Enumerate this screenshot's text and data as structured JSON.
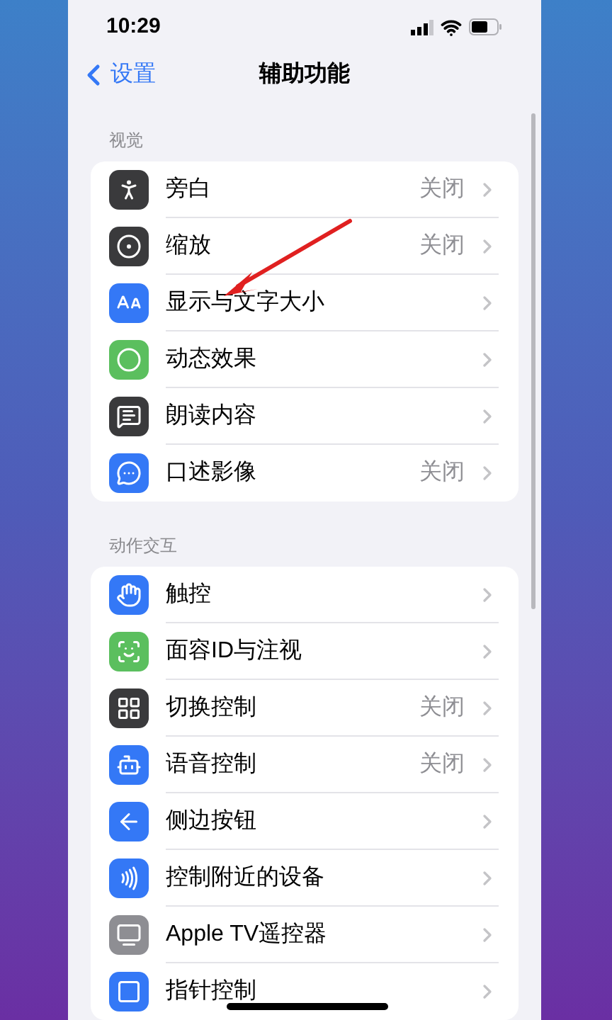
{
  "status_bar": {
    "time": "10:29"
  },
  "nav": {
    "back": "设置",
    "title": "辅助功能"
  },
  "sections": [
    {
      "header": "视觉",
      "items": [
        {
          "kind": "voiceover",
          "color": "#3a3a3c",
          "label": "旁白",
          "value": "关闭"
        },
        {
          "kind": "zoom",
          "color": "#3a3a3c",
          "label": "缩放",
          "value": "关闭"
        },
        {
          "kind": "text-size",
          "color": "#3478f6",
          "label": "显示与文字大小"
        },
        {
          "kind": "motion",
          "color": "#5bbf5e",
          "label": "动态效果"
        },
        {
          "kind": "spoken",
          "color": "#3a3a3c",
          "label": "朗读内容"
        },
        {
          "kind": "audio-desc",
          "color": "#3478f6",
          "label": "口述影像",
          "value": "关闭"
        }
      ]
    },
    {
      "header": "动作交互",
      "items": [
        {
          "kind": "touch",
          "color": "#3478f6",
          "label": "触控"
        },
        {
          "kind": "face-id",
          "color": "#5bbf5e",
          "label": "面容ID与注视"
        },
        {
          "kind": "switch",
          "color": "#3a3a3c",
          "label": "切换控制",
          "value": "关闭"
        },
        {
          "kind": "voice",
          "color": "#3478f6",
          "label": "语音控制",
          "value": "关闭"
        },
        {
          "kind": "side-button",
          "color": "#3478f6",
          "label": "侧边按钮"
        },
        {
          "kind": "nearby",
          "color": "#3478f6",
          "label": "控制附近的设备"
        },
        {
          "kind": "remote",
          "color": "#8e8e93",
          "label": "Apple TV遥控器"
        },
        {
          "kind": "pointer",
          "color": "#3478f6",
          "label": "指针控制"
        }
      ]
    }
  ]
}
